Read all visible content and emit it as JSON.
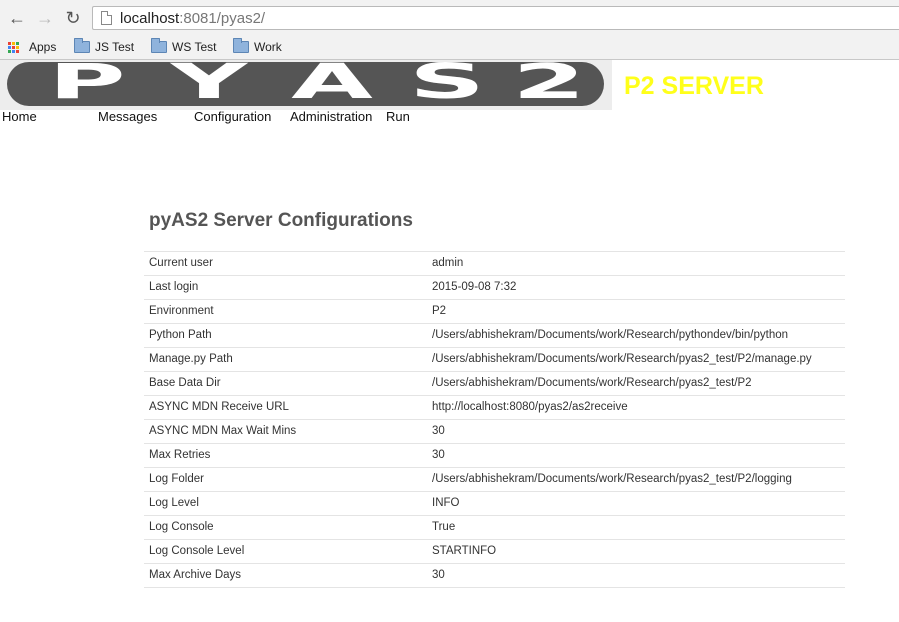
{
  "browser": {
    "url_host": "localhost",
    "url_rest": ":8081/pyas2/",
    "bookmarks": [
      {
        "label": "Apps",
        "icon": "apps-grid-icon"
      },
      {
        "label": "JS Test",
        "icon": "folder-icon"
      },
      {
        "label": "WS Test",
        "icon": "folder-icon"
      },
      {
        "label": "Work",
        "icon": "folder-icon"
      }
    ]
  },
  "header": {
    "logo_letters": [
      "P",
      "Y",
      "A",
      "S",
      "2"
    ],
    "server_title": "P2 SERVER",
    "server_title_color": "#ffff1a"
  },
  "menu": [
    "Home",
    "Messages",
    "Configuration",
    "Administration",
    "Run"
  ],
  "main": {
    "title": "pyAS2 Server Configurations",
    "rows": [
      {
        "key": "Current user",
        "value": "admin"
      },
      {
        "key": "Last login",
        "value": "2015-09-08 7:32"
      },
      {
        "key": "Environment",
        "value": "P2"
      },
      {
        "key": "Python Path",
        "value": "/Users/abhishekram/Documents/work/Research/pythondev/bin/python"
      },
      {
        "key": "Manage.py Path",
        "value": "/Users/abhishekram/Documents/work/Research/pyas2_test/P2/manage.py"
      },
      {
        "key": "Base Data Dir",
        "value": "/Users/abhishekram/Documents/work/Research/pyas2_test/P2"
      },
      {
        "key": "ASYNC MDN Receive URL",
        "value": "http://localhost:8080/pyas2/as2receive"
      },
      {
        "key": "ASYNC MDN Max Wait Mins",
        "value": "30"
      },
      {
        "key": "Max Retries",
        "value": "30"
      },
      {
        "key": "Log Folder",
        "value": "/Users/abhishekram/Documents/work/Research/pyas2_test/P2/logging"
      },
      {
        "key": "Log Level",
        "value": "INFO"
      },
      {
        "key": "Log Console",
        "value": "True"
      },
      {
        "key": "Log Console Level",
        "value": "STARTINFO"
      },
      {
        "key": "Max Archive Days",
        "value": "30"
      }
    ]
  }
}
